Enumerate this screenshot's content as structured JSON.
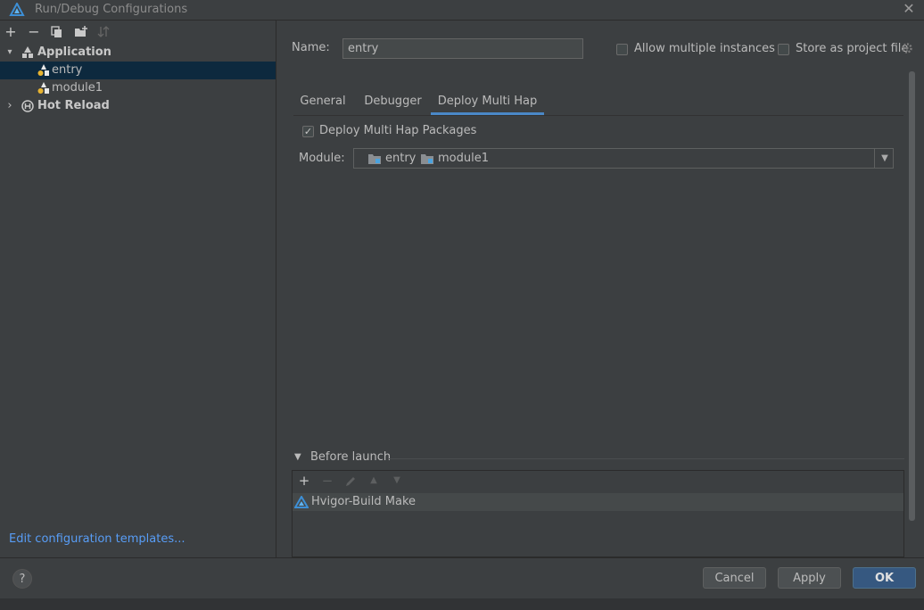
{
  "window": {
    "title": "Run/Debug Configurations",
    "close_glyph": "✕"
  },
  "toolbar": {
    "add": "+",
    "remove": "−",
    "copy": "copy-icon",
    "folder": "new-folder-icon",
    "sort": "sort-icon"
  },
  "tree": {
    "application": {
      "label": "Application",
      "chevron": "▾"
    },
    "items": [
      {
        "label": "entry"
      },
      {
        "label": "module1"
      }
    ],
    "hot_reload": {
      "label": "Hot Reload",
      "chevron": "›"
    }
  },
  "edit_templates_link": "Edit configuration templates...",
  "name": {
    "label": "Name:",
    "value": "entry"
  },
  "options": {
    "allow_multiple": "Allow multiple instances",
    "store_as_project": "Store as project file"
  },
  "tabs": [
    {
      "label": "General"
    },
    {
      "label": "Debugger"
    },
    {
      "label": "Deploy Multi Hap",
      "active": true
    }
  ],
  "deploy": {
    "checkbox_label": "Deploy Multi Hap Packages",
    "checked": true,
    "module_label": "Module:",
    "modules": [
      "entry",
      "module1"
    ]
  },
  "before_launch": {
    "label": "Before launch",
    "item": "Hvigor-Build Make"
  },
  "buttons": {
    "cancel": "Cancel",
    "apply": "Apply",
    "ok": "OK",
    "help": "?"
  },
  "colors": {
    "accent": "#4a88c7",
    "selection": "#0d293e",
    "link": "#589df6",
    "ok_button": "#365880"
  }
}
